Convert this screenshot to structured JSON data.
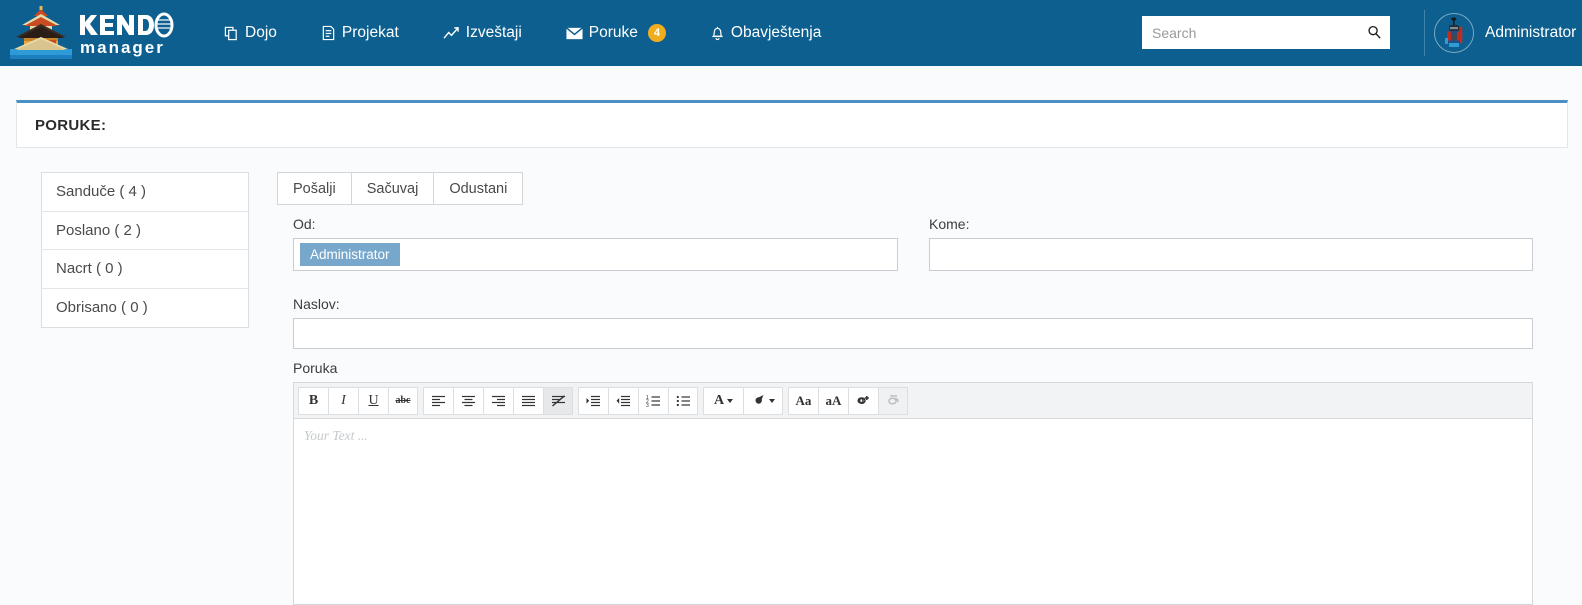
{
  "brand": {
    "name_top": "KENDO",
    "name_bottom": "manager",
    "colors": {
      "header_blue": "#0c5f8e",
      "badge_amber": "#f0ad1e",
      "panel_accent": "#4a90c4",
      "token_blue": "#77a8cc"
    }
  },
  "nav": {
    "items": [
      {
        "label": "Dojo",
        "icon": "copy-icon"
      },
      {
        "label": "Projekat",
        "icon": "document-icon"
      },
      {
        "label": "Izveštaji",
        "icon": "chart-line-icon"
      },
      {
        "label": "Poruke",
        "icon": "envelope-icon",
        "badge": "4"
      },
      {
        "label": "Obavještenja",
        "icon": "bell-icon"
      }
    ]
  },
  "search": {
    "placeholder": "Search",
    "value": "",
    "icon": "search-icon"
  },
  "user": {
    "name": "Administrator",
    "avatar": "kendo-warrior-avatar"
  },
  "page": {
    "title": "PORUKE:"
  },
  "folders": {
    "items": [
      {
        "label": "Sanduče ( 4 )"
      },
      {
        "label": "Poslano ( 2 )"
      },
      {
        "label": "Nacrt ( 0 )"
      },
      {
        "label": "Obrisano ( 0 )"
      }
    ]
  },
  "actions": {
    "send": "Pošalji",
    "save": "Sačuvaj",
    "cancel": "Odustani"
  },
  "form": {
    "from_label": "Od:",
    "from_token": "Administrator",
    "to_label": "Kome:",
    "to_value": "",
    "subject_label": "Naslov:",
    "subject_value": "",
    "message_label": "Poruka",
    "message_placeholder": "Your Text ..."
  },
  "toolbar": {
    "buttons": [
      {
        "name": "bold-icon",
        "glyph": "B"
      },
      {
        "name": "italic-icon",
        "glyph": "I"
      },
      {
        "name": "underline-icon",
        "glyph": "U"
      },
      {
        "name": "strikethrough-icon",
        "glyph": "abc"
      },
      {
        "name": "align-left-icon",
        "glyph": ""
      },
      {
        "name": "align-center-icon",
        "glyph": ""
      },
      {
        "name": "align-right-icon",
        "glyph": ""
      },
      {
        "name": "align-justify-icon",
        "glyph": ""
      },
      {
        "name": "clear-formatting-icon",
        "glyph": ""
      },
      {
        "name": "indent-increase-icon",
        "glyph": ""
      },
      {
        "name": "indent-decrease-icon",
        "glyph": ""
      },
      {
        "name": "ordered-list-icon",
        "glyph": ""
      },
      {
        "name": "unordered-list-icon",
        "glyph": ""
      },
      {
        "name": "text-color-icon",
        "glyph": "A"
      },
      {
        "name": "highlight-color-icon",
        "glyph": ""
      },
      {
        "name": "uppercase-icon",
        "glyph": "Aa"
      },
      {
        "name": "lowercase-icon",
        "glyph": "aA"
      },
      {
        "name": "insert-link-icon",
        "glyph": ""
      },
      {
        "name": "remove-link-icon",
        "glyph": ""
      }
    ]
  }
}
